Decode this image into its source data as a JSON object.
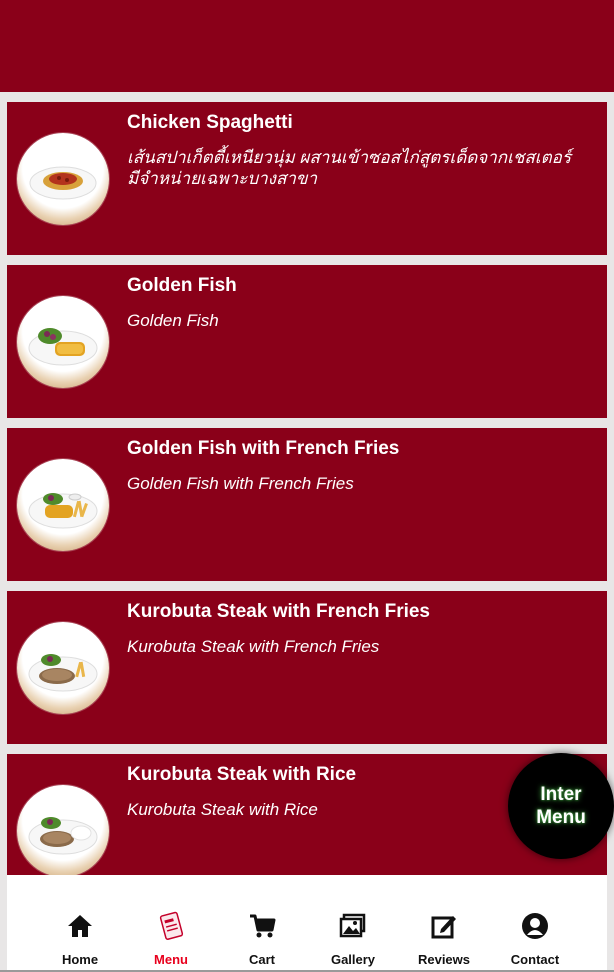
{
  "menu_items": [
    {
      "title": "Chicken Spaghetti",
      "description": "เส้นสปาเก็ตตี้เหนียวนุ่ม ผสานเข้าซอสไก่สูตรเด็ดจากเชสเตอร์ มีจำหน่ายเฉพาะบางสาขา",
      "icon": "spaghetti-plate-image"
    },
    {
      "title": "Golden Fish",
      "description": "Golden Fish",
      "icon": "fish-plate-image"
    },
    {
      "title": "Golden Fish with French Fries",
      "description": "Golden Fish with French Fries",
      "icon": "fish-fries-plate-image"
    },
    {
      "title": "Kurobuta Steak with French Fries",
      "description": "Kurobuta Steak with French Fries",
      "icon": "steak-fries-plate-image"
    },
    {
      "title": "Kurobuta Steak with Rice",
      "description": "Kurobuta Steak with Rice",
      "icon": "steak-rice-plate-image"
    }
  ],
  "fab": {
    "line1": "Inter",
    "line2": "Menu"
  },
  "nav": {
    "home": "Home",
    "menu": "Menu",
    "cart": "Cart",
    "gallery": "Gallery",
    "reviews": "Reviews",
    "contact": "Contact",
    "active": "Menu"
  },
  "colors": {
    "primary": "#8a0019",
    "active_nav": "#e8001d",
    "background": "#e8e6e6"
  }
}
